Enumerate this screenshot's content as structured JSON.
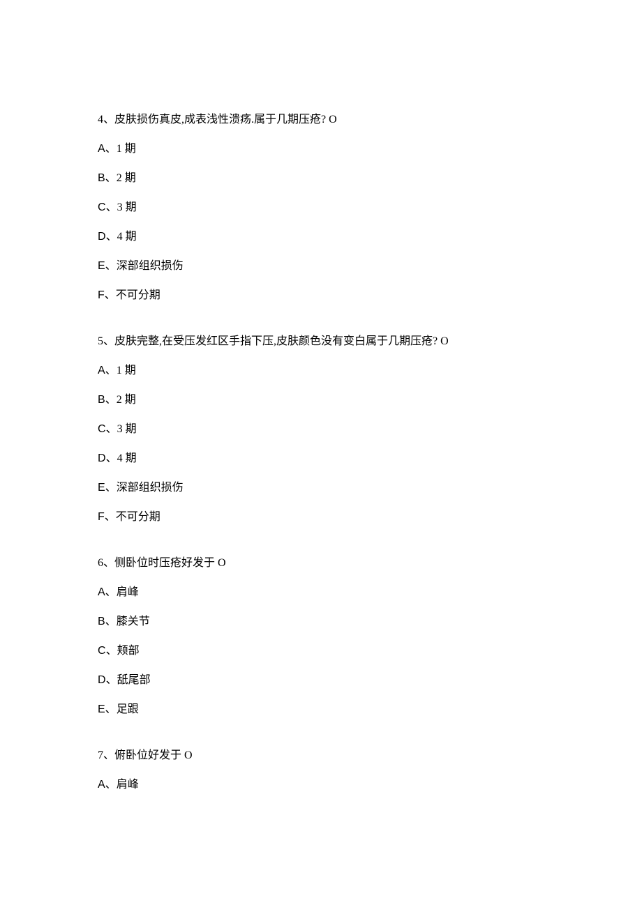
{
  "questions": [
    {
      "number": "4",
      "text": "皮肤损伤真皮,成表浅性溃疡.属于几期压疮? O",
      "options": [
        {
          "letter": "A",
          "text": "1 期"
        },
        {
          "letter": "B",
          "text": "2 期"
        },
        {
          "letter": "C",
          "text": "3 期"
        },
        {
          "letter": "D",
          "text": "4 期"
        },
        {
          "letter": "E",
          "text": "深部组织损伤"
        },
        {
          "letter": "F",
          "text": "不可分期"
        }
      ]
    },
    {
      "number": "5",
      "text": "皮肤完整,在受压发红区手指下压,皮肤颜色没有变白属于几期压疮? O",
      "options": [
        {
          "letter": "A",
          "text": "1 期"
        },
        {
          "letter": "B",
          "text": "2 期"
        },
        {
          "letter": "C",
          "text": "3 期"
        },
        {
          "letter": "D",
          "text": "4 期"
        },
        {
          "letter": "E",
          "text": "深部组织损伤"
        },
        {
          "letter": "F",
          "text": "不可分期"
        }
      ]
    },
    {
      "number": "6",
      "text": "侧卧位时压疮好发于 O",
      "options": [
        {
          "letter": "A",
          "text": "肩峰"
        },
        {
          "letter": "B",
          "text": "膝关节"
        },
        {
          "letter": "C",
          "text": "颊部"
        },
        {
          "letter": "D",
          "text": "舐尾部"
        },
        {
          "letter": "E",
          "text": "足跟"
        }
      ]
    },
    {
      "number": "7",
      "text": "俯卧位好发于 O",
      "options": [
        {
          "letter": "A",
          "text": "肩峰"
        }
      ]
    }
  ]
}
